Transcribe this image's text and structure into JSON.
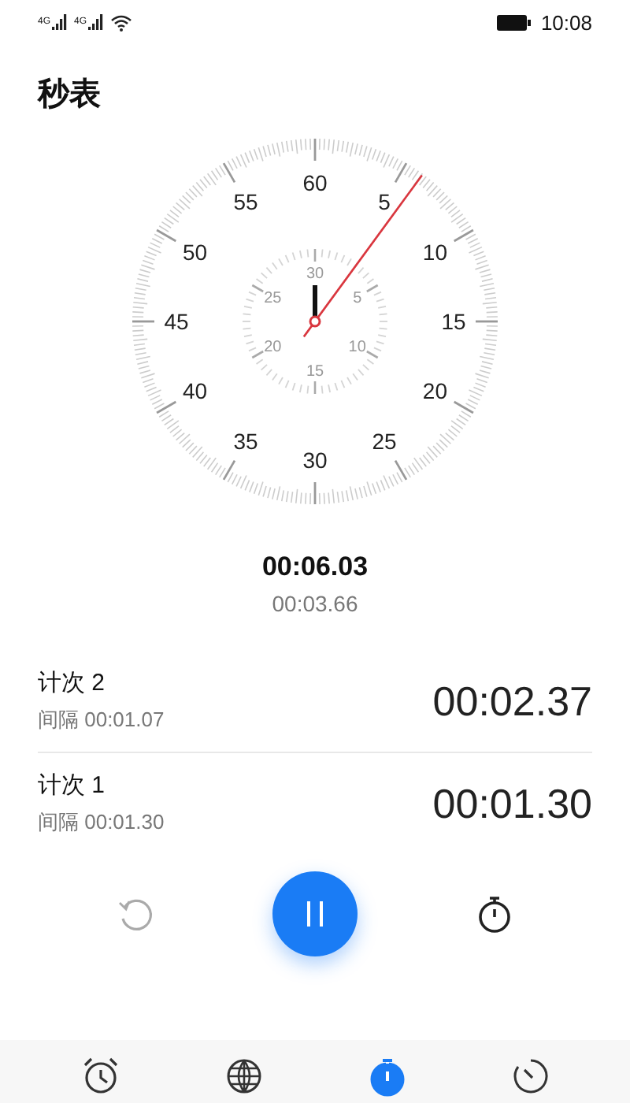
{
  "status_bar": {
    "signals": [
      {
        "label": "4G"
      },
      {
        "label": "4G"
      }
    ],
    "time": "10:08"
  },
  "title": "秒表",
  "dial": {
    "outer_labels": [
      "60",
      "5",
      "10",
      "15",
      "20",
      "25",
      "30",
      "35",
      "40",
      "45",
      "50",
      "55"
    ],
    "inner_labels": [
      "30",
      "5",
      "10",
      "15",
      "20",
      "25"
    ]
  },
  "elapsed": "00:06.03",
  "current_lap": "00:03.66",
  "laps": [
    {
      "name": "计次 2",
      "interval": "间隔 00:01.07",
      "time": "00:02.37"
    },
    {
      "name": "计次 1",
      "interval": "间隔 00:01.30",
      "time": "00:01.30"
    }
  ],
  "controls": [
    {
      "kind": "reset",
      "disabled": true
    },
    {
      "kind": "pause",
      "disabled": false
    },
    {
      "kind": "lap",
      "disabled": false
    }
  ],
  "tabs": [
    {
      "kind": "alarm",
      "selected": false
    },
    {
      "kind": "world",
      "selected": false
    },
    {
      "kind": "stopwatch",
      "selected": true
    },
    {
      "kind": "timer",
      "selected": false
    }
  ]
}
